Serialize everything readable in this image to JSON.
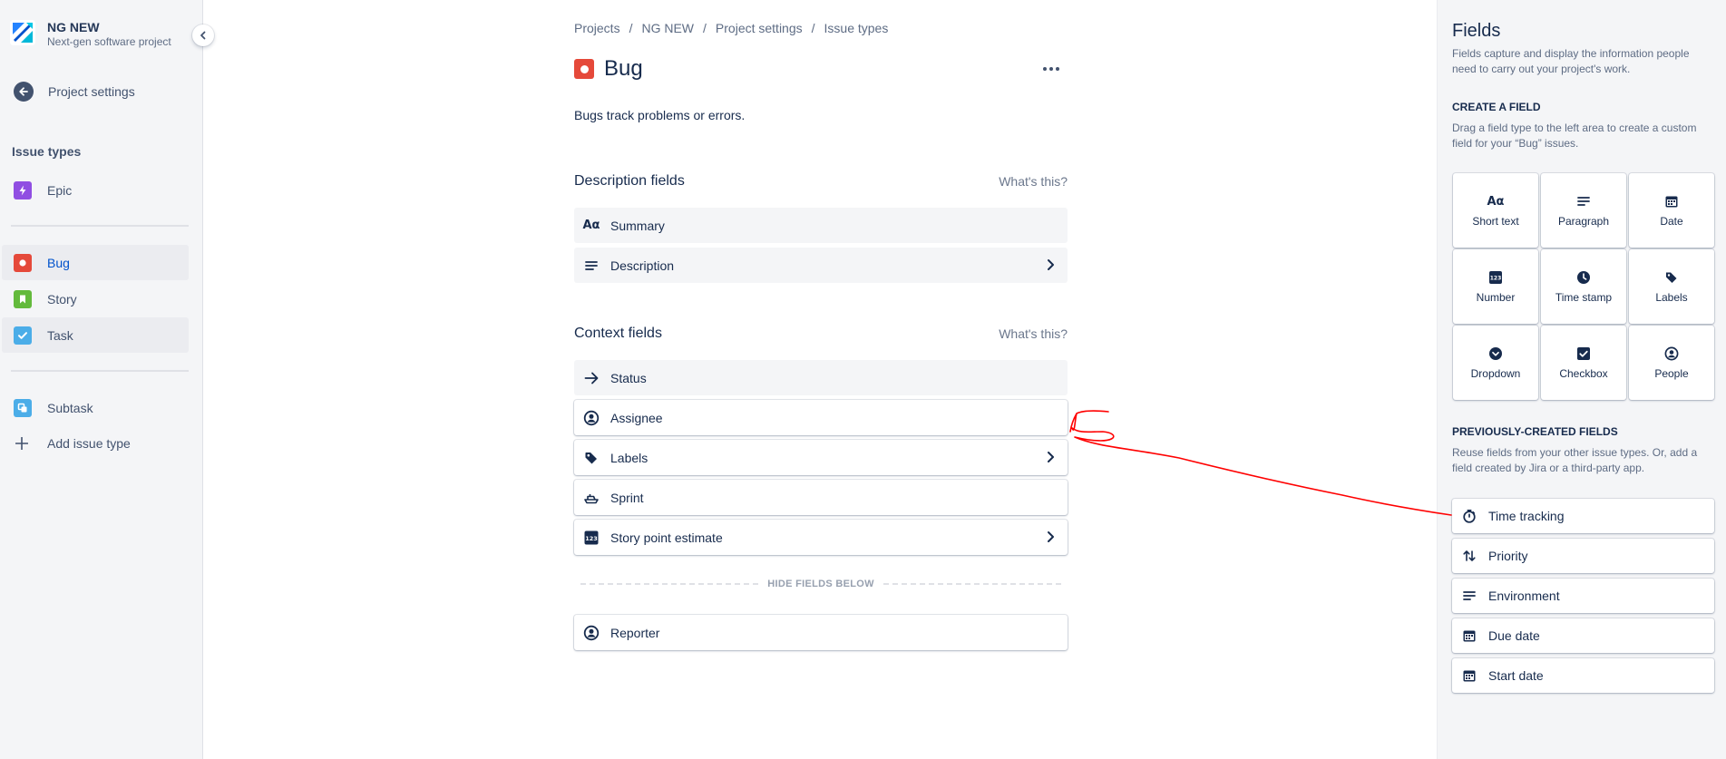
{
  "project": {
    "name": "NG NEW",
    "subtitle": "Next-gen software project"
  },
  "sidebar": {
    "back_label": "Project settings",
    "issue_types_heading": "Issue types",
    "epic": "Epic",
    "bug": "Bug",
    "story": "Story",
    "task": "Task",
    "subtask": "Subtask",
    "add_issue_type": "Add issue type"
  },
  "breadcrumbs": [
    "Projects",
    "NG NEW",
    "Project settings",
    "Issue types"
  ],
  "issue": {
    "title": "Bug",
    "description": "Bugs track problems or errors."
  },
  "description_fields": {
    "heading": "Description fields",
    "help": "What's this?",
    "items": [
      "Summary",
      "Description"
    ]
  },
  "context_fields": {
    "heading": "Context fields",
    "help": "What's this?",
    "items": [
      "Status",
      "Assignee",
      "Labels",
      "Sprint",
      "Story point estimate"
    ],
    "hide_label": "HIDE FIELDS BELOW",
    "hidden_items": [
      "Reporter"
    ]
  },
  "fields_panel": {
    "title": "Fields",
    "intro": "Fields capture and display the information people need to carry out your project's work.",
    "create_heading": "CREATE A FIELD",
    "create_text": "Drag a field type to the left area to create a custom field for your “Bug” issues.",
    "types": [
      "Short text",
      "Paragraph",
      "Date",
      "Number",
      "Time stamp",
      "Labels",
      "Dropdown",
      "Checkbox",
      "People"
    ],
    "prev_heading": "PREVIOUSLY-CREATED FIELDS",
    "prev_text": "Reuse fields from your other issue types. Or, add a field created by Jira or a third-party app.",
    "previous": [
      "Time tracking",
      "Priority",
      "Environment",
      "Due date",
      "Start date"
    ]
  },
  "colors": {
    "bug": "#e5493a",
    "epic": "#904ee2",
    "story": "#63ba3c",
    "task": "#4bade8",
    "annotation": "#ff0000"
  }
}
